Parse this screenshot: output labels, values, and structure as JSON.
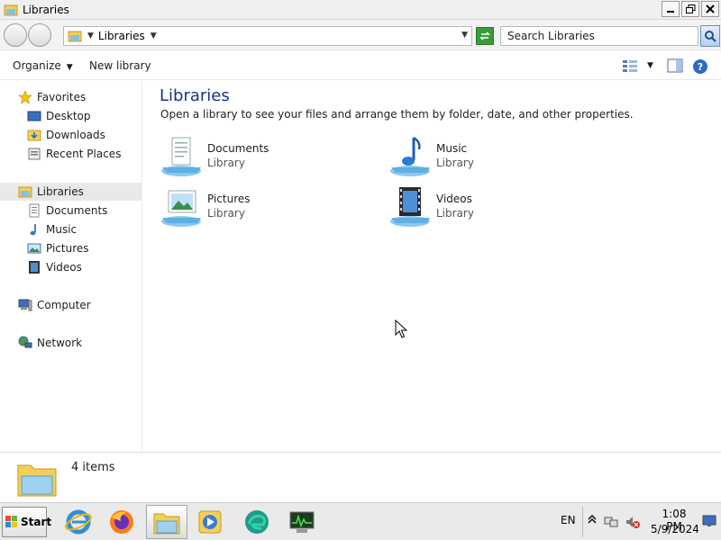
{
  "window": {
    "title": "Libraries"
  },
  "address": {
    "crumb": "Libraries"
  },
  "search": {
    "placeholder": "Search Libraries"
  },
  "commands": {
    "organize": "Organize",
    "new_library": "New library"
  },
  "nav": {
    "favorites": {
      "label": "Favorites",
      "items": [
        "Desktop",
        "Downloads",
        "Recent Places"
      ]
    },
    "libraries": {
      "label": "Libraries",
      "items": [
        "Documents",
        "Music",
        "Pictures",
        "Videos"
      ]
    },
    "computer": "Computer",
    "network": "Network"
  },
  "main": {
    "title": "Libraries",
    "description": "Open a library to see your files and arrange them by folder, date, and other properties.",
    "libraries": [
      {
        "name": "Documents",
        "type": "Library"
      },
      {
        "name": "Music",
        "type": "Library"
      },
      {
        "name": "Pictures",
        "type": "Library"
      },
      {
        "name": "Videos",
        "type": "Library"
      }
    ]
  },
  "details": {
    "count": "4 items"
  },
  "taskbar": {
    "start": "Start",
    "lang": "EN",
    "time": "1:08 PM",
    "date": "5/9/2024"
  },
  "colors": {
    "title_blue": "#1e3287",
    "folder_yellow": "#f2cf57",
    "library_blue": "#4aa7e0"
  }
}
